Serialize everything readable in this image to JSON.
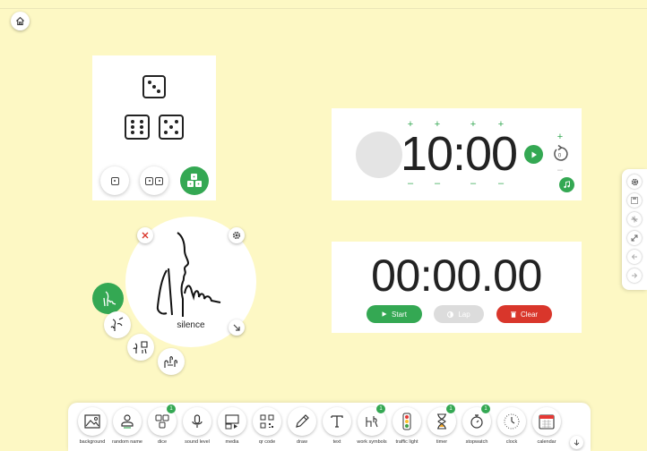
{
  "colors": {
    "background": "#fdf8c4",
    "accent": "#34a853",
    "danger": "#d9362b"
  },
  "timer": {
    "display": "10:00",
    "increment_symbol": "+",
    "decrement_symbol": "–",
    "reset_count": "0"
  },
  "stopwatch": {
    "display": "00:00.00",
    "start_label": "Start",
    "lap_label": "Lap",
    "clear_label": "Clear"
  },
  "work_symbol": {
    "label": "silence"
  },
  "toolbar": {
    "items": [
      {
        "label": "background",
        "icon": "image-icon"
      },
      {
        "label": "random name",
        "icon": "person-shuffle-icon"
      },
      {
        "label": "dice",
        "icon": "dice-icon",
        "badge": "1"
      },
      {
        "label": "sound level",
        "icon": "microphone-icon"
      },
      {
        "label": "media",
        "icon": "media-icon"
      },
      {
        "label": "qr code",
        "icon": "qr-code-icon"
      },
      {
        "label": "draw",
        "icon": "pencil-icon"
      },
      {
        "label": "text",
        "icon": "text-icon"
      },
      {
        "label": "work symbols",
        "icon": "work-symbols-icon",
        "badge": "1"
      },
      {
        "label": "traffic light",
        "icon": "traffic-light-icon"
      },
      {
        "label": "timer",
        "icon": "hourglass-icon",
        "badge": "1"
      },
      {
        "label": "stopwatch",
        "icon": "stopwatch-icon",
        "badge": "1"
      },
      {
        "label": "clock",
        "icon": "clock-icon"
      },
      {
        "label": "calendar",
        "icon": "calendar-icon"
      }
    ]
  }
}
